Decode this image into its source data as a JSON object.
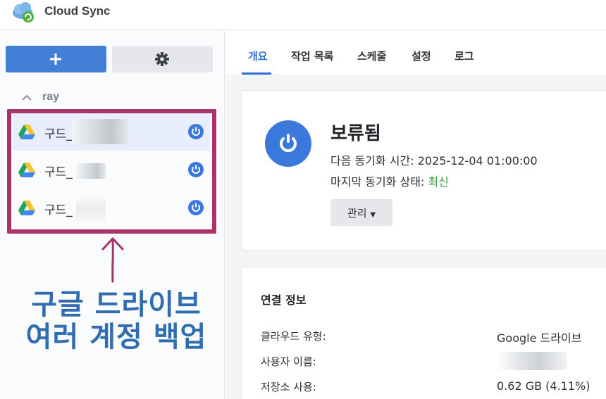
{
  "app": {
    "title": "Cloud Sync"
  },
  "sidebar": {
    "add_button": {
      "icon": "plus-icon"
    },
    "settings_button": {
      "icon": "gear-icon"
    },
    "group": {
      "label": "ray"
    },
    "accounts": [
      {
        "name": "구드_",
        "selected": true
      },
      {
        "name": "구드_",
        "selected": false
      },
      {
        "name": "구드_",
        "selected": false
      }
    ]
  },
  "annotation": {
    "color": "#a8326a",
    "caption_line1": "구글 드라이브",
    "caption_line2": "여러 계정 백업"
  },
  "tabs": [
    {
      "label": "개요",
      "active": true
    },
    {
      "label": "작업 목록",
      "active": false
    },
    {
      "label": "스케줄",
      "active": false
    },
    {
      "label": "설정",
      "active": false
    },
    {
      "label": "로그",
      "active": false
    }
  ],
  "status": {
    "title": "보류됨",
    "next_sync_label": "다음 동기화 시간:",
    "next_sync_value": "2025-12-04 01:00:00",
    "last_sync_label": "마지막 동기화 상태:",
    "last_sync_value": "최신",
    "manage_button": "관리"
  },
  "connection": {
    "title": "연결 정보",
    "cloud_type_label": "클라우드 유형:",
    "cloud_type_value": "Google 드라이브",
    "username_label": "사용자 이름:",
    "storage_label": "저장소 사용:",
    "storage_value": "0.62 GB (4.11%)"
  },
  "colors": {
    "accent": "#3a79db",
    "ok": "#3a9a3a",
    "caption": "#2f6db0"
  }
}
